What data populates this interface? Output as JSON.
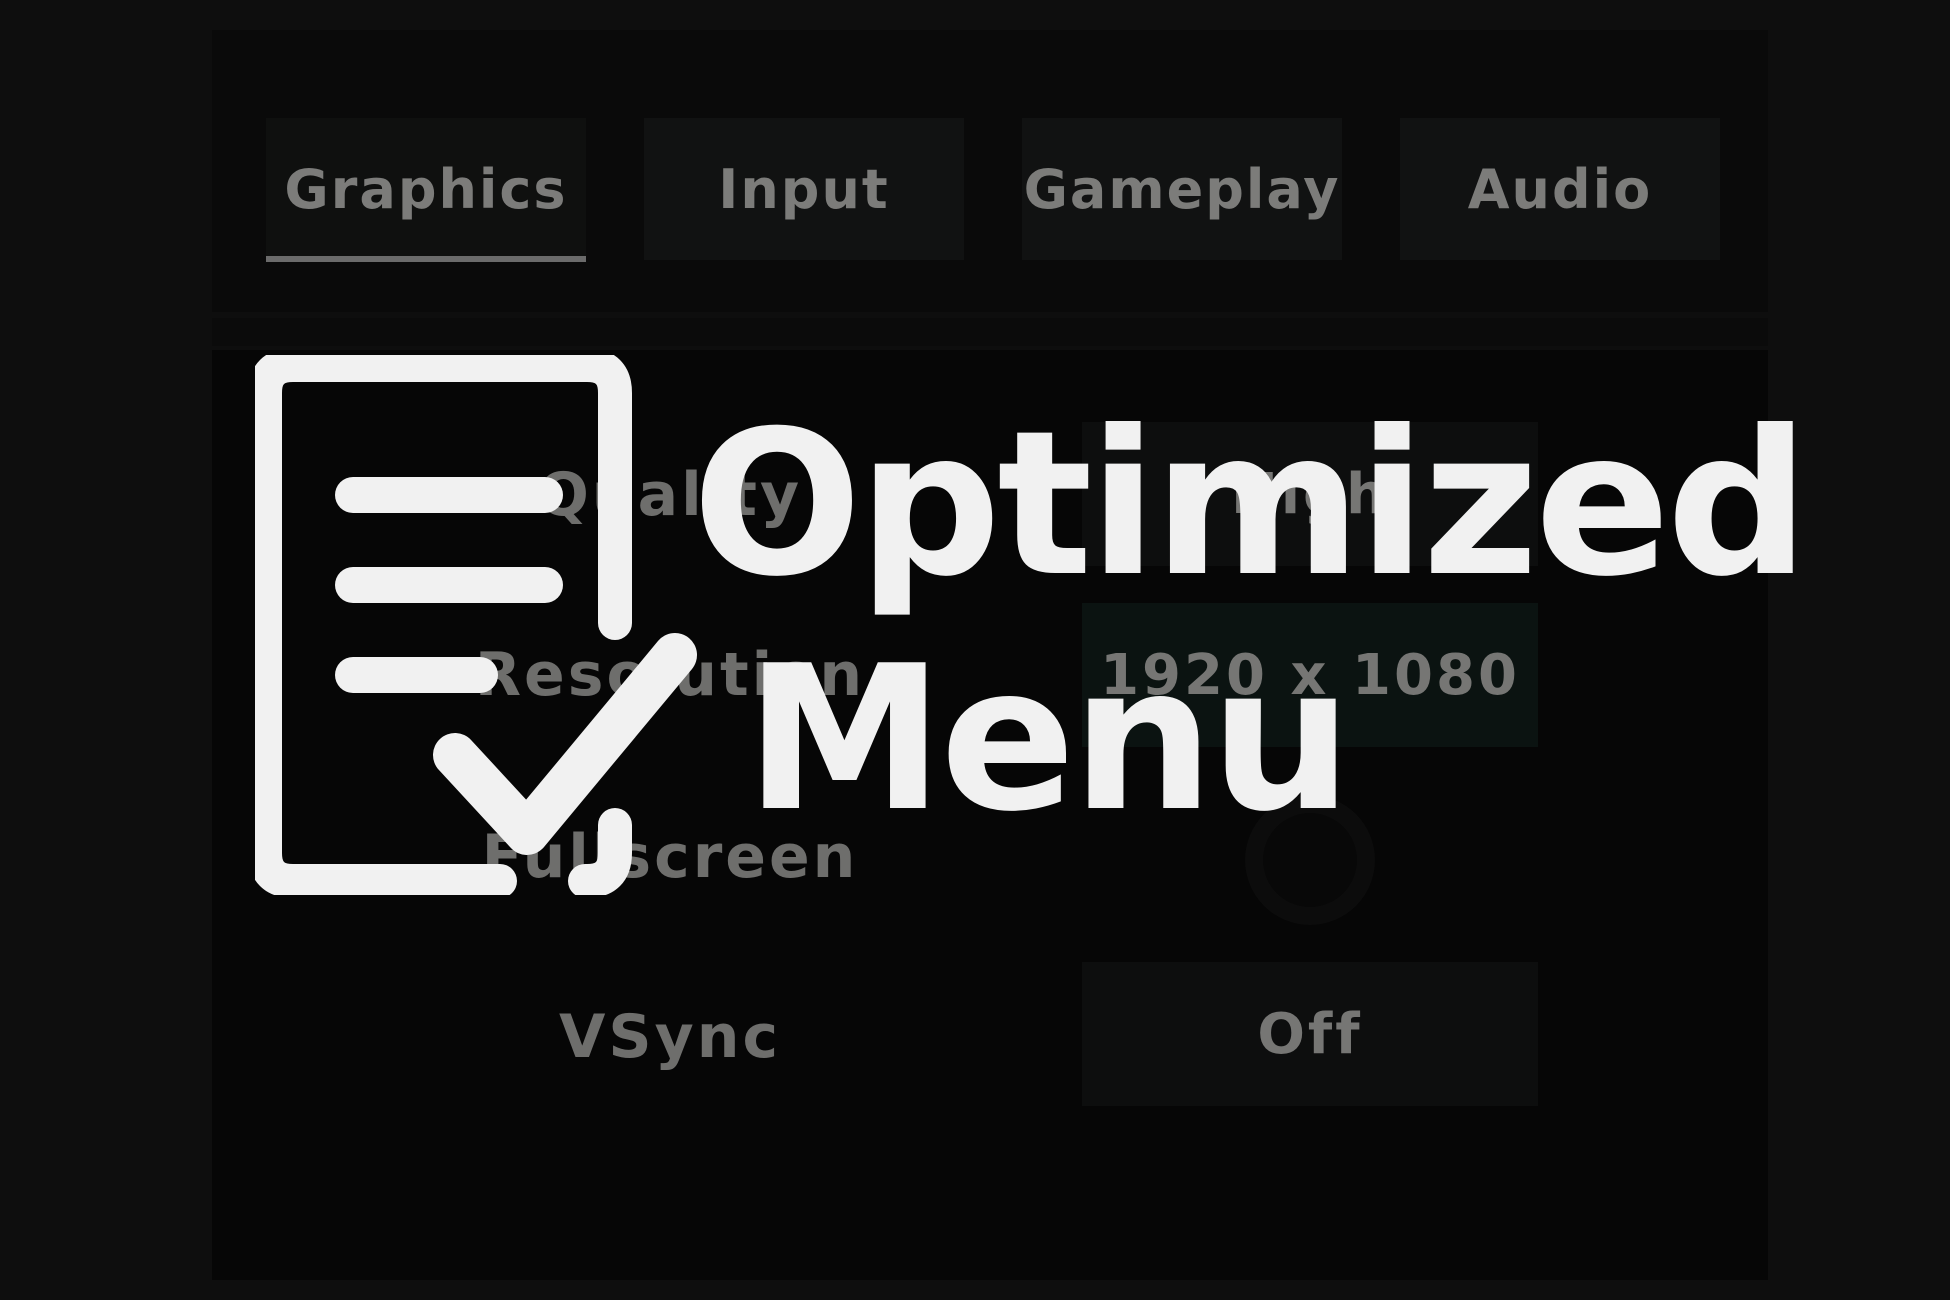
{
  "tabs": [
    {
      "label": "Graphics",
      "active": true
    },
    {
      "label": "Input",
      "active": false
    },
    {
      "label": "Gameplay",
      "active": false
    },
    {
      "label": "Audio",
      "active": false
    }
  ],
  "settings": {
    "quality": {
      "label": "Quality",
      "value": "High"
    },
    "resolution": {
      "label": "Resolution",
      "value": "1920 x 1080"
    },
    "fullscreen": {
      "label": "Fullscreen"
    },
    "vsync": {
      "label": "VSync",
      "value": "Off"
    }
  },
  "overlay": {
    "line1": "Optimized",
    "line2": "Menu",
    "icon": "document-check-icon"
  },
  "colors": {
    "background": "#0e0e0e",
    "text_dim": "#7c7c7a",
    "overlay_text": "#f1f1f1"
  }
}
